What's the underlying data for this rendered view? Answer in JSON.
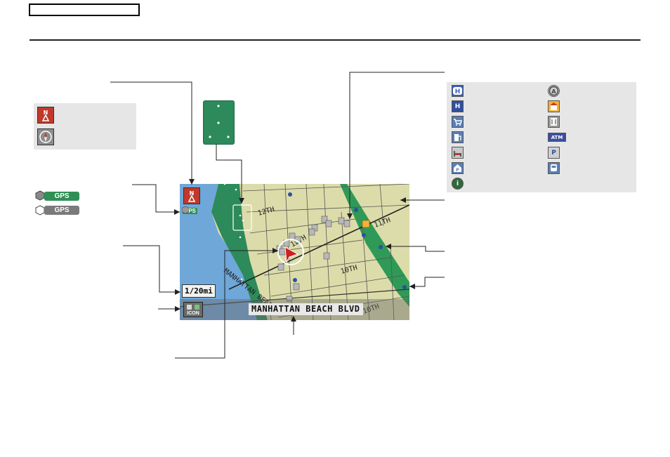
{
  "map": {
    "scale": "1/20mi",
    "road_name": "MANHATTAN BEACH BLVD",
    "streets": [
      "12TH",
      "12TH",
      "11TH",
      "10TH",
      "10TH",
      "MANHATTAN BEACH"
    ],
    "gps_label": "GPS",
    "icon_button_label": "ICON"
  },
  "gps_legend": {
    "badge_1": "GPS",
    "badge_2": "GPS"
  },
  "landmark_legend": {
    "items": [
      "honda-dealer-icon",
      "acura-dealer-icon",
      "hospital-icon",
      "school-icon",
      "shopping-icon",
      "restaurant-icon",
      "gas-station-icon",
      "atm-icon",
      "hotel-icon",
      "parking-icon",
      "post-office-icon",
      "train-station-icon",
      "information-icon"
    ],
    "atm_text": "ATM",
    "parking_text": "P",
    "hospital_text": "H",
    "info_text": "i"
  },
  "colors": {
    "water": "#6fa7d9",
    "park": "#2d8a5a",
    "land": "#dcdcaa",
    "highway": "#2f9a57",
    "panel": "#e6e6e6"
  }
}
